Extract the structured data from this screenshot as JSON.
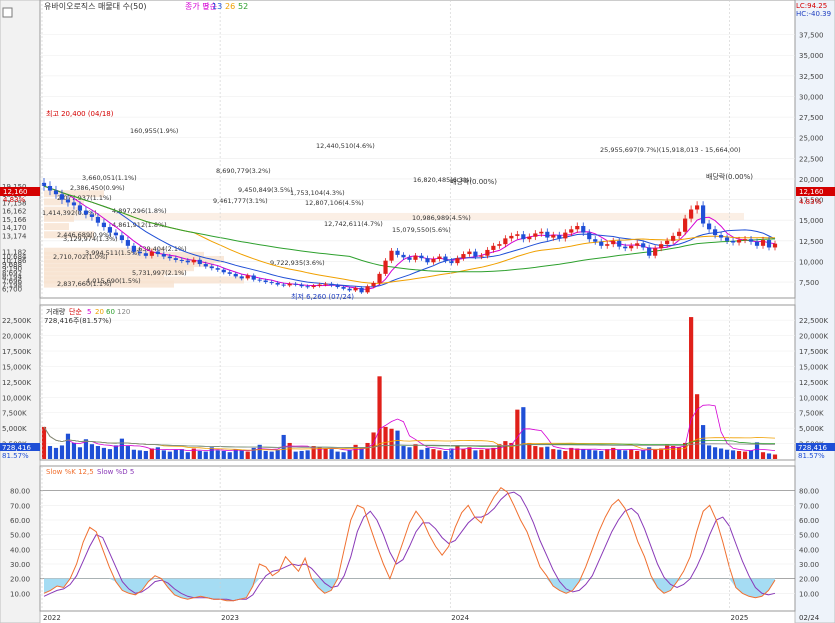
{
  "header": {
    "stock_label": "유바이오로직스 매물대 수(50)",
    "ma_label": "종가 단순",
    "ma_periods": [
      "5",
      "13",
      "26",
      "52"
    ],
    "ma_colors": [
      "#d400d4",
      "#1f4fd6",
      "#f0a000",
      "#2ea02e"
    ],
    "lc_label": "LC:94.25",
    "hc_label": "HC:-40.39"
  },
  "price_panel": {
    "ylim": [
      6300,
      40000
    ],
    "right_ticks": [
      "37,500",
      "35,000",
      "32,500",
      "30,000",
      "27,500",
      "25,000",
      "22,500",
      "20,000",
      "17,500",
      "15,000",
      "12,500",
      "10,000",
      "7,500"
    ],
    "right_tick_values": [
      37500,
      35000,
      32500,
      30000,
      27500,
      25000,
      22500,
      20000,
      17500,
      15000,
      12500,
      10000,
      7500
    ],
    "left_ticks": [
      "19,150",
      "18,154",
      "17,158",
      "16,162",
      "15,166",
      "14,170",
      "13,174",
      "11,182",
      "10,684",
      "10,186",
      "9,688",
      "9,190",
      "8,692",
      "8,194",
      "7,696",
      "7,198",
      "6,700"
    ],
    "left_tick_values": [
      19150,
      18154,
      17158,
      16162,
      15166,
      14170,
      13174,
      11182,
      10684,
      10186,
      9688,
      9190,
      8692,
      8194,
      7696,
      7198,
      6700
    ],
    "current_price_label": "12,160",
    "current_price_value": 12160,
    "current_change_label": "4.83%",
    "annotations": [
      {
        "text": "최고 20,400 (04/18)",
        "color": "#d40000"
      },
      {
        "text": "최저 6,260 (07/24)",
        "color": "#1f3fc0"
      },
      {
        "text": "배당락(0.00%)",
        "color": "#333333"
      },
      {
        "text": "배당락(0.00%)",
        "color": "#333333"
      }
    ],
    "volume_profile_labels": [
      "12,440,510(4.6%)",
      "8,690,779(3.2%)",
      "25,955,697(9.7%)(15,918,013 - 15,664,00)",
      "9,450,849(3.5%)",
      "9,461,777(3.1%)",
      "12,807,106(4.5%)",
      "16,820,485(6.3%)",
      "2,386,450(0.9%)",
      "2,077,937(1.1%)",
      "1,414,392(0.5%)",
      "4,897,296(1.8%)",
      "4,861,912(1.8%)",
      "12,742,611(4.7%)",
      "15,079,550(5.6%)",
      "2,446,689(0.9%)",
      "3,129,974(1.3%)",
      "2,710,702(1.0%)",
      "3,994,511(1.5%)",
      "5,639,404(2.1%)",
      "5,731,997(2.1%)",
      "4,015,690(1.5%)",
      "2,837,660(1.1%)",
      "1,753,104(4.3%)",
      "10,986,989(4.5%)",
      "9,722,935(3.6%)",
      "3,660,051(1.1%)",
      "160,955(1.9%)"
    ]
  },
  "volume_panel": {
    "legend": [
      "거래량",
      "단순",
      "5",
      "20",
      "60",
      "120"
    ],
    "legend_colors": [
      "#333333",
      "#d40000",
      "#d400d4",
      "#f0a000",
      "#2ea02e",
      "#888888"
    ],
    "sublabel": "728,416주(81.57%)",
    "ylim": [
      0,
      23500
    ],
    "ticks": [
      "22,500K",
      "20,000K",
      "17,500K",
      "15,000K",
      "12,500K",
      "10,000K",
      "7,500K",
      "5,000K",
      "2,500K"
    ],
    "tick_values": [
      22500,
      20000,
      17500,
      15000,
      12500,
      10000,
      7500,
      5000,
      2500
    ],
    "current_label": "728,416",
    "pct_label": "81.57%"
  },
  "stoch_panel": {
    "legend": [
      "Slow %K 12,5",
      "Slow %D 5"
    ],
    "legend_colors": [
      "#f07030",
      "#8a3ab8"
    ],
    "ylim": [
      0,
      90
    ],
    "ticks": [
      "80.00",
      "70.00",
      "60.00",
      "50.00",
      "40.00",
      "30.00",
      "20.00",
      "10.00"
    ],
    "tick_values": [
      80,
      70,
      60,
      50,
      40,
      30,
      20,
      10
    ]
  },
  "x_axis": {
    "labels": [
      "2022",
      "2023",
      "2024",
      "2025"
    ],
    "label_fractions": [
      0.0,
      0.243,
      0.557,
      0.938
    ],
    "right_label": "02/24"
  },
  "chart_data": {
    "type": "candlestick",
    "note_series": "weekly close prices approximated",
    "close": [
      19150,
      18600,
      18154,
      17500,
      17158,
      16800,
      16162,
      15700,
      15400,
      14700,
      14170,
      13500,
      13174,
      12600,
      11900,
      11182,
      11000,
      10684,
      11200,
      10900,
      10600,
      10400,
      10186,
      10100,
      9900,
      10200,
      9688,
      9400,
      9190,
      9000,
      8692,
      8500,
      8194,
      7950,
      8300,
      7800,
      7696,
      7500,
      7400,
      7198,
      7100,
      7300,
      7200,
      7000,
      6900,
      7050,
      7200,
      7300,
      7100,
      6900,
      6700,
      6500,
      6800,
      6260,
      7000,
      7400,
      8500,
      10100,
      11300,
      10800,
      10500,
      10200,
      10700,
      10400,
      9900,
      10300,
      10600,
      10100,
      9800,
      10400,
      10900,
      11200,
      10600,
      10700,
      11400,
      11900,
      12100,
      12800,
      13100,
      13300,
      12700,
      13000,
      13400,
      13600,
      12900,
      13200,
      12800,
      13500,
      13900,
      14300,
      13500,
      12700,
      12400,
      11900,
      12100,
      12500,
      11800,
      11600,
      11900,
      12200,
      11700,
      10700,
      11600,
      12100,
      12500,
      13100,
      13600,
      15200,
      16300,
      16800,
      14600,
      13900,
      13200,
      12900,
      12500,
      12300,
      12600,
      12700,
      12400,
      11900,
      12600,
      11700,
      12160
    ],
    "volume_k": [
      5200,
      2100,
      1800,
      2200,
      4100,
      2600,
      1900,
      3200,
      2400,
      2100,
      1800,
      1600,
      2200,
      3300,
      2100,
      1500,
      1400,
      1300,
      1700,
      1900,
      1400,
      1200,
      1500,
      1600,
      1100,
      1700,
      1300,
      1200,
      1900,
      1400,
      1300,
      1100,
      1600,
      1500,
      1200,
      1800,
      2300,
      1300,
      1200,
      1500,
      3900,
      2600,
      1200,
      1300,
      1400,
      2100,
      1900,
      1700,
      1600,
      1200,
      1100,
      1500,
      2300,
      1700,
      2600,
      4300,
      13400,
      5200,
      4900,
      4600,
      2100,
      1900,
      2400,
      1500,
      1800,
      1600,
      1400,
      1300,
      1700,
      2100,
      1600,
      1900,
      1400,
      1500,
      1700,
      1800,
      2400,
      2900,
      2600,
      8000,
      8400,
      2600,
      2100,
      1900,
      2000,
      1600,
      1500,
      1300,
      1800,
      1700,
      1600,
      1500,
      1400,
      1300,
      1600,
      1800,
      1500,
      1400,
      1500,
      1300,
      1400,
      1900,
      1500,
      1700,
      2300,
      2100,
      1900,
      2600,
      23000,
      10500,
      5500,
      2200,
      1900,
      1700,
      1500,
      1400,
      1300,
      1200,
      1400,
      2700,
      1100,
      900,
      728
    ],
    "slow_k": [
      10,
      12,
      15,
      14,
      20,
      30,
      45,
      55,
      52,
      40,
      28,
      18,
      12,
      10,
      9,
      12,
      18,
      22,
      20,
      14,
      9,
      7,
      6,
      7,
      8,
      7,
      6,
      6,
      5,
      5,
      6,
      7,
      15,
      30,
      28,
      22,
      25,
      35,
      30,
      25,
      34,
      20,
      14,
      10,
      12,
      20,
      40,
      60,
      70,
      68,
      55,
      42,
      30,
      20,
      32,
      45,
      58,
      66,
      60,
      50,
      42,
      36,
      42,
      55,
      65,
      70,
      62,
      58,
      68,
      76,
      82,
      79,
      70,
      60,
      52,
      40,
      28,
      22,
      15,
      12,
      10,
      12,
      18,
      28,
      40,
      52,
      62,
      70,
      74,
      68,
      58,
      45,
      35,
      22,
      14,
      10,
      12,
      18,
      25,
      35,
      52,
      66,
      70,
      60,
      45,
      28,
      14,
      10,
      8,
      7,
      8,
      12,
      19
    ],
    "slow_d": [
      8,
      10,
      12,
      13,
      16,
      22,
      32,
      42,
      50,
      48,
      38,
      28,
      18,
      13,
      10,
      11,
      14,
      18,
      19,
      17,
      13,
      10,
      8,
      7,
      7,
      7,
      6,
      6,
      6,
      5,
      6,
      6,
      9,
      16,
      22,
      25,
      26,
      28,
      30,
      29,
      30,
      27,
      22,
      17,
      14,
      15,
      22,
      35,
      52,
      62,
      66,
      60,
      50,
      38,
      30,
      33,
      42,
      52,
      58,
      58,
      54,
      48,
      44,
      46,
      52,
      58,
      62,
      62,
      64,
      68,
      74,
      78,
      79,
      76,
      68,
      58,
      46,
      36,
      26,
      18,
      13,
      11,
      12,
      16,
      22,
      32,
      42,
      52,
      60,
      66,
      68,
      64,
      54,
      42,
      30,
      21,
      16,
      14,
      16,
      20,
      28,
      38,
      50,
      60,
      62,
      56,
      44,
      32,
      22,
      14,
      10,
      9,
      10
    ]
  }
}
